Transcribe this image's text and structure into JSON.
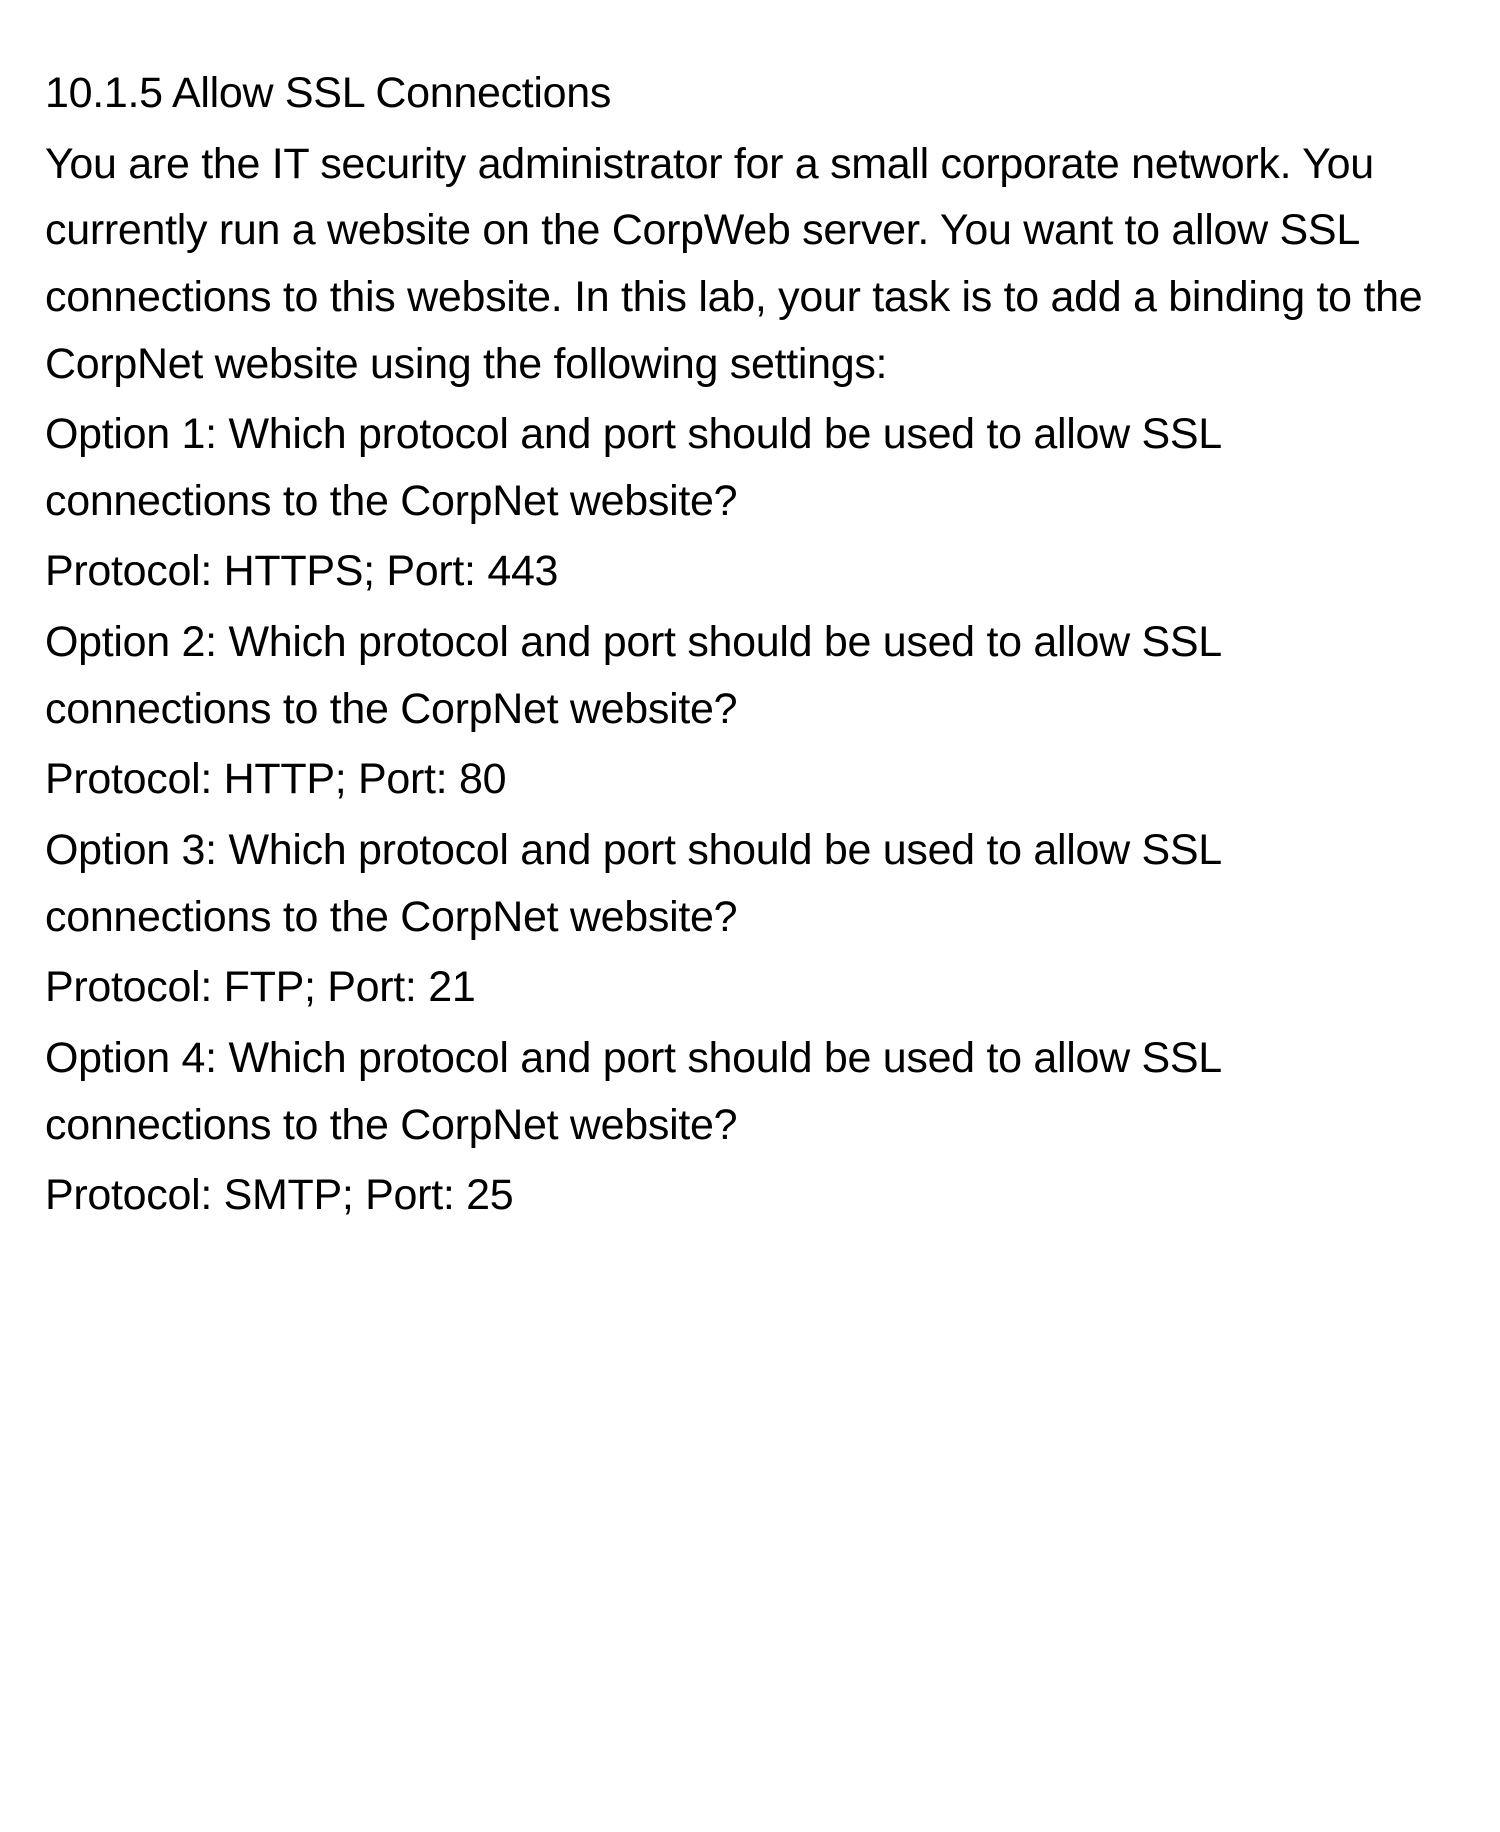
{
  "heading": "10.1.5 Allow SSL Connections",
  "intro": "You are the IT security administrator for a small corporate network. You currently run a website on the CorpWeb server. You want to allow SSL connections to this website. In this lab, your task is to add a binding to the CorpNet website using the following settings:",
  "options": [
    {
      "question": "Option 1: Which protocol and port should be used to allow SSL connections to the CorpNet website?",
      "answer": "Protocol: HTTPS; Port: 443"
    },
    {
      "question": "Option 2: Which protocol and port should be used to allow SSL connections to the CorpNet website?",
      "answer": "Protocol: HTTP; Port: 80"
    },
    {
      "question": "Option 3: Which protocol and port should be used to allow SSL connections to the CorpNet website?",
      "answer": "Protocol: FTP; Port: 21"
    },
    {
      "question": "Option 4: Which protocol and port should be used to allow SSL connections to the CorpNet website?",
      "answer": "Protocol: SMTP; Port: 25"
    }
  ]
}
